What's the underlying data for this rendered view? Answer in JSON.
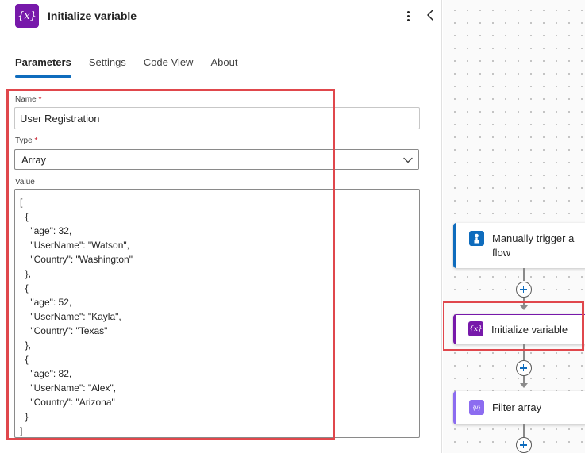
{
  "panel": {
    "icon_glyph": "{x}",
    "title": "Initialize variable",
    "tabs": [
      {
        "label": "Parameters",
        "active": true
      },
      {
        "label": "Settings",
        "active": false
      },
      {
        "label": "Code View",
        "active": false
      },
      {
        "label": "About",
        "active": false
      }
    ],
    "name_field": {
      "label": "Name",
      "required_mark": "*",
      "value": "User Registration"
    },
    "type_field": {
      "label": "Type",
      "required_mark": "*",
      "value": "Array"
    },
    "value_field": {
      "label": "Value",
      "value": "[\n  {\n    \"age\": 32,\n    \"UserName\": \"Watson\",\n    \"Country\": \"Washington\"\n  },\n  {\n    \"age\": 52,\n    \"UserName\": \"Kayla\",\n    \"Country\": \"Texas\"\n  },\n  {\n    \"age\": 82,\n    \"UserName\": \"Alex\",\n    \"Country\": \"Arizona\"\n  }\n]"
    }
  },
  "flow": {
    "nodes": [
      {
        "label": "Manually trigger a flow",
        "icon": "manual-trigger-icon",
        "accent": "#0f6cbd",
        "icon_bg": "#0f6cbd"
      },
      {
        "label": "Initialize variable",
        "icon": "variable-icon",
        "accent": "#7719aa",
        "icon_bg": "#7719aa"
      },
      {
        "label": "Filter array",
        "icon": "filter-array-icon",
        "accent": "#8c6cf0",
        "icon_bg": "#8c6cf0"
      }
    ],
    "variable_glyph": "{x}",
    "filter_glyph": "{v}"
  },
  "colors": {
    "accent_blue": "#0f6cbd",
    "highlight_red": "#e0474c",
    "variable_purple": "#7719aa"
  }
}
